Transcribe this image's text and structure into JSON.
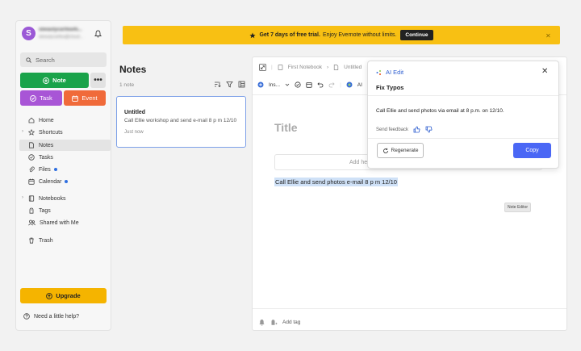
{
  "account": {
    "initial": "S",
    "name": "sbeautycarltea45...",
    "email": "sbeautycarltea@icloud..."
  },
  "sidebar": {
    "search_placeholder": "Search",
    "note_label": "Note",
    "more_label": "•••",
    "task_label": "Task",
    "event_label": "Event",
    "items": [
      {
        "label": "Home",
        "icon": "home-icon"
      },
      {
        "label": "Shortcuts",
        "icon": "star-icon",
        "expandable": true
      },
      {
        "label": "Notes",
        "icon": "note-icon",
        "active": true
      },
      {
        "label": "Tasks",
        "icon": "check-circle-icon"
      },
      {
        "label": "Files",
        "icon": "paperclip-icon",
        "dot": true
      },
      {
        "label": "Calendar",
        "icon": "calendar-icon",
        "dot": true
      },
      {
        "label": "Notebooks",
        "icon": "notebook-icon",
        "expandable": true
      },
      {
        "label": "Tags",
        "icon": "tag-icon"
      },
      {
        "label": "Shared with Me",
        "icon": "people-icon"
      },
      {
        "label": "Trash",
        "icon": "trash-icon"
      }
    ],
    "upgrade_label": "Upgrade",
    "help_label": "Need a little help?"
  },
  "banner": {
    "bold_text": "Get 7 days of free trial.",
    "text": "Enjoy Evernote without limits.",
    "button_label": "Continue",
    "close": "✕"
  },
  "notes_list": {
    "title": "Notes",
    "count": "1 note",
    "card": {
      "title": "Untitled",
      "snippet": "Call Ellie workshop and send e-mail 8 p m 12/10",
      "time": "Just now"
    }
  },
  "editor": {
    "breadcrumb_notebook": "First Notebook",
    "breadcrumb_note": "Untitled",
    "toolbar_insert": "Ins...",
    "toolbar_ai": "AI",
    "title_placeholder": "Title",
    "add_heading": "Add he",
    "body_text": "Call Ellie and send photos e-mail  8 p m 12/10",
    "tooltip": "Note Editor",
    "add_tag": "Add tag"
  },
  "ai_panel": {
    "header": "AI Edit",
    "action": "Fix Typos",
    "result": "Call Ellie and send photos via email at 8 p.m. on 12/10.",
    "feedback_label": "Send feedback",
    "regenerate_label": "Regenerate",
    "copy_label": "Copy",
    "close": "✕"
  },
  "colors": {
    "note_green": "#1aa34a",
    "task_purple": "#a855d6",
    "event_orange": "#f06a3a",
    "upgrade_yellow": "#f5b400",
    "banner_yellow": "#f8c013",
    "copy_blue": "#4a67f5"
  }
}
